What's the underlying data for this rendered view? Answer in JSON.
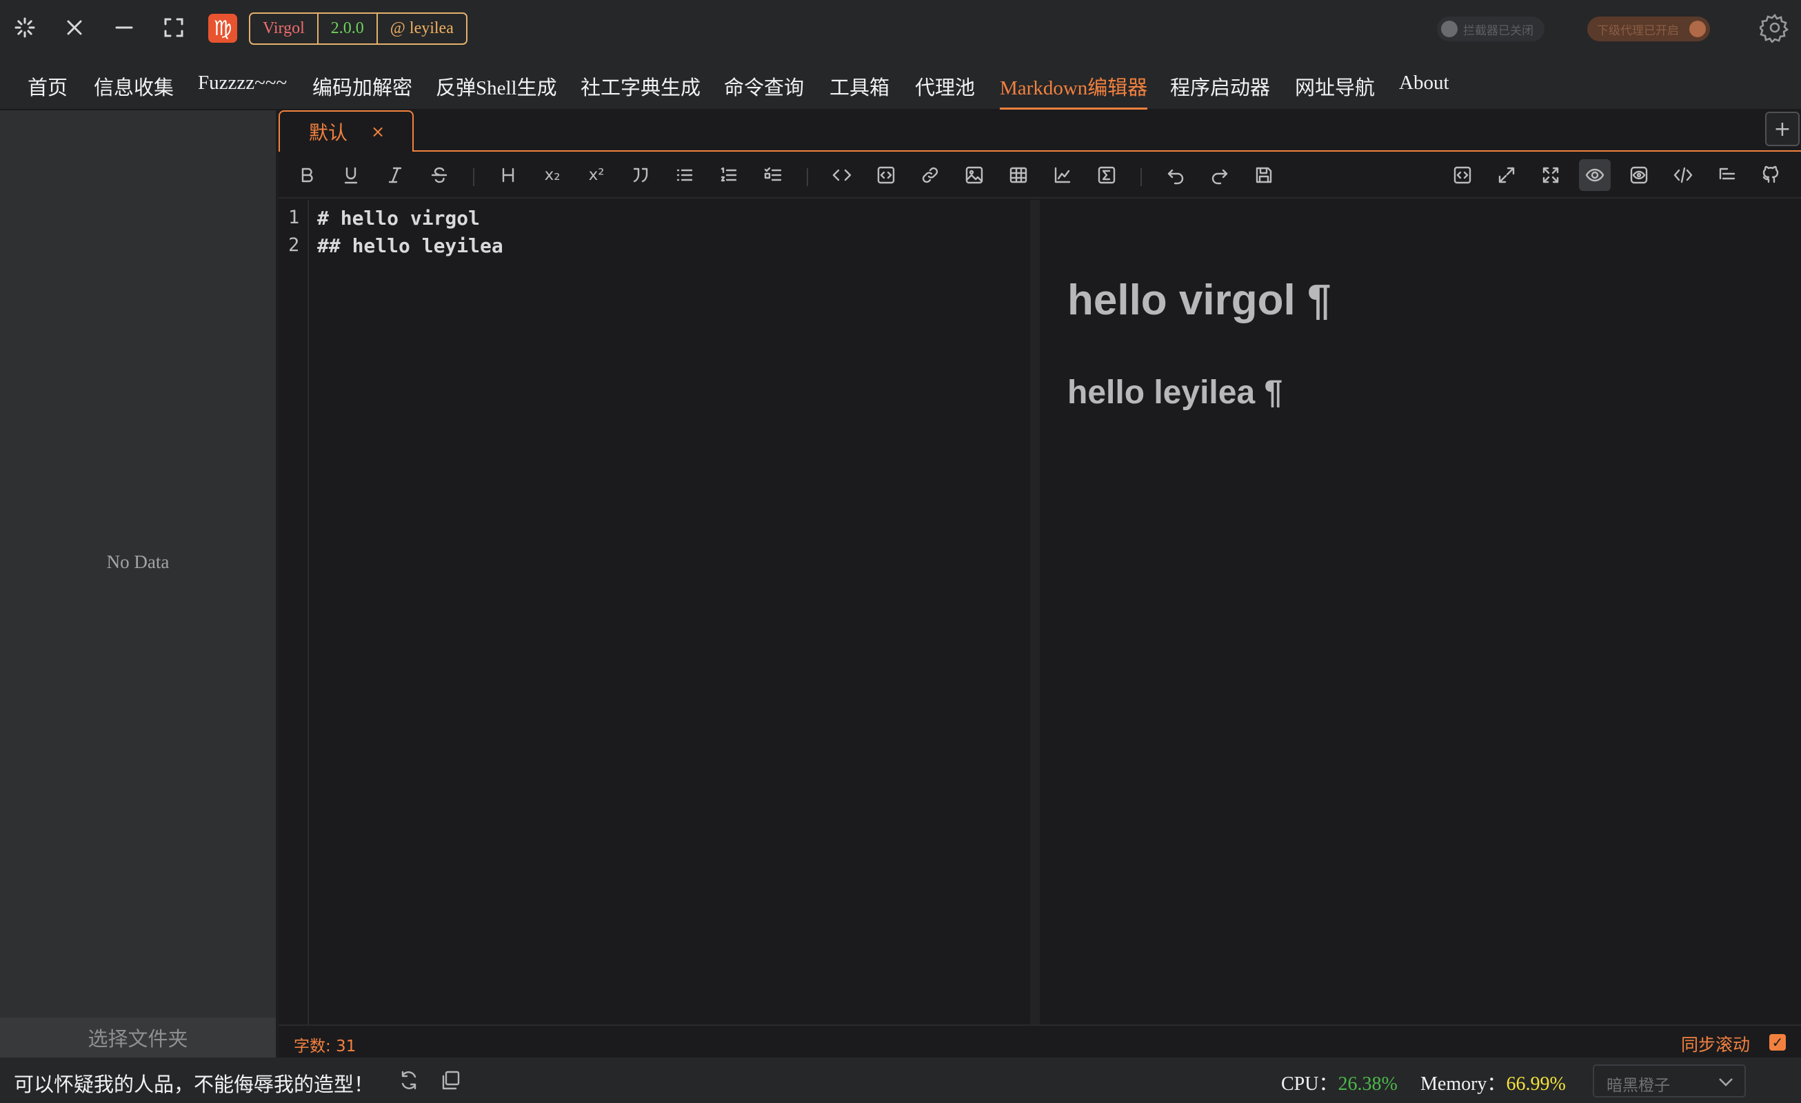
{
  "titlebar": {
    "logo_glyph": "♍",
    "app_name": "Virgol",
    "version": "2.0.0",
    "author": "@ leyilea",
    "interceptor_toggle": "拦截器已关闭",
    "proxy_toggle": "下级代理已开启"
  },
  "menu": {
    "items": [
      "首页",
      "信息收集",
      "Fuzzzz~~~",
      "编码加解密",
      "反弹Shell生成",
      "社工字典生成",
      "命令查询",
      "工具箱",
      "代理池",
      "Markdown编辑器",
      "程序启动器",
      "网址导航",
      "About"
    ],
    "active": "Markdown编辑器"
  },
  "sidebar": {
    "empty_text": "No Data",
    "select_folder": "选择文件夹"
  },
  "editor": {
    "tab_label": "默认",
    "tab_close": "×",
    "add_tab": "+",
    "toolbar": {
      "subscript": "x₂",
      "superscript": "x²"
    },
    "lines": [
      {
        "no": "1",
        "text": "# hello virgol"
      },
      {
        "no": "2",
        "text": "## hello leyilea"
      }
    ],
    "preview": {
      "h1": "hello virgol",
      "h2": "hello leyilea",
      "pilcrow": "¶"
    },
    "word_count": "字数: 31",
    "sync_scroll": "同步滚动",
    "sync_checked": "✓"
  },
  "footer": {
    "quote": "可以怀疑我的人品，不能侮辱我的造型！",
    "cpu_label": "CPU：",
    "cpu_value": "26.38%",
    "memory_label": "Memory：",
    "memory_value": "66.99%",
    "theme_selected": "暗黑橙子"
  },
  "colors": {
    "accent": "#f2813f",
    "cpu": "#4cb84a",
    "memory": "#f4e23c",
    "logo_bg": "#e8542f"
  }
}
